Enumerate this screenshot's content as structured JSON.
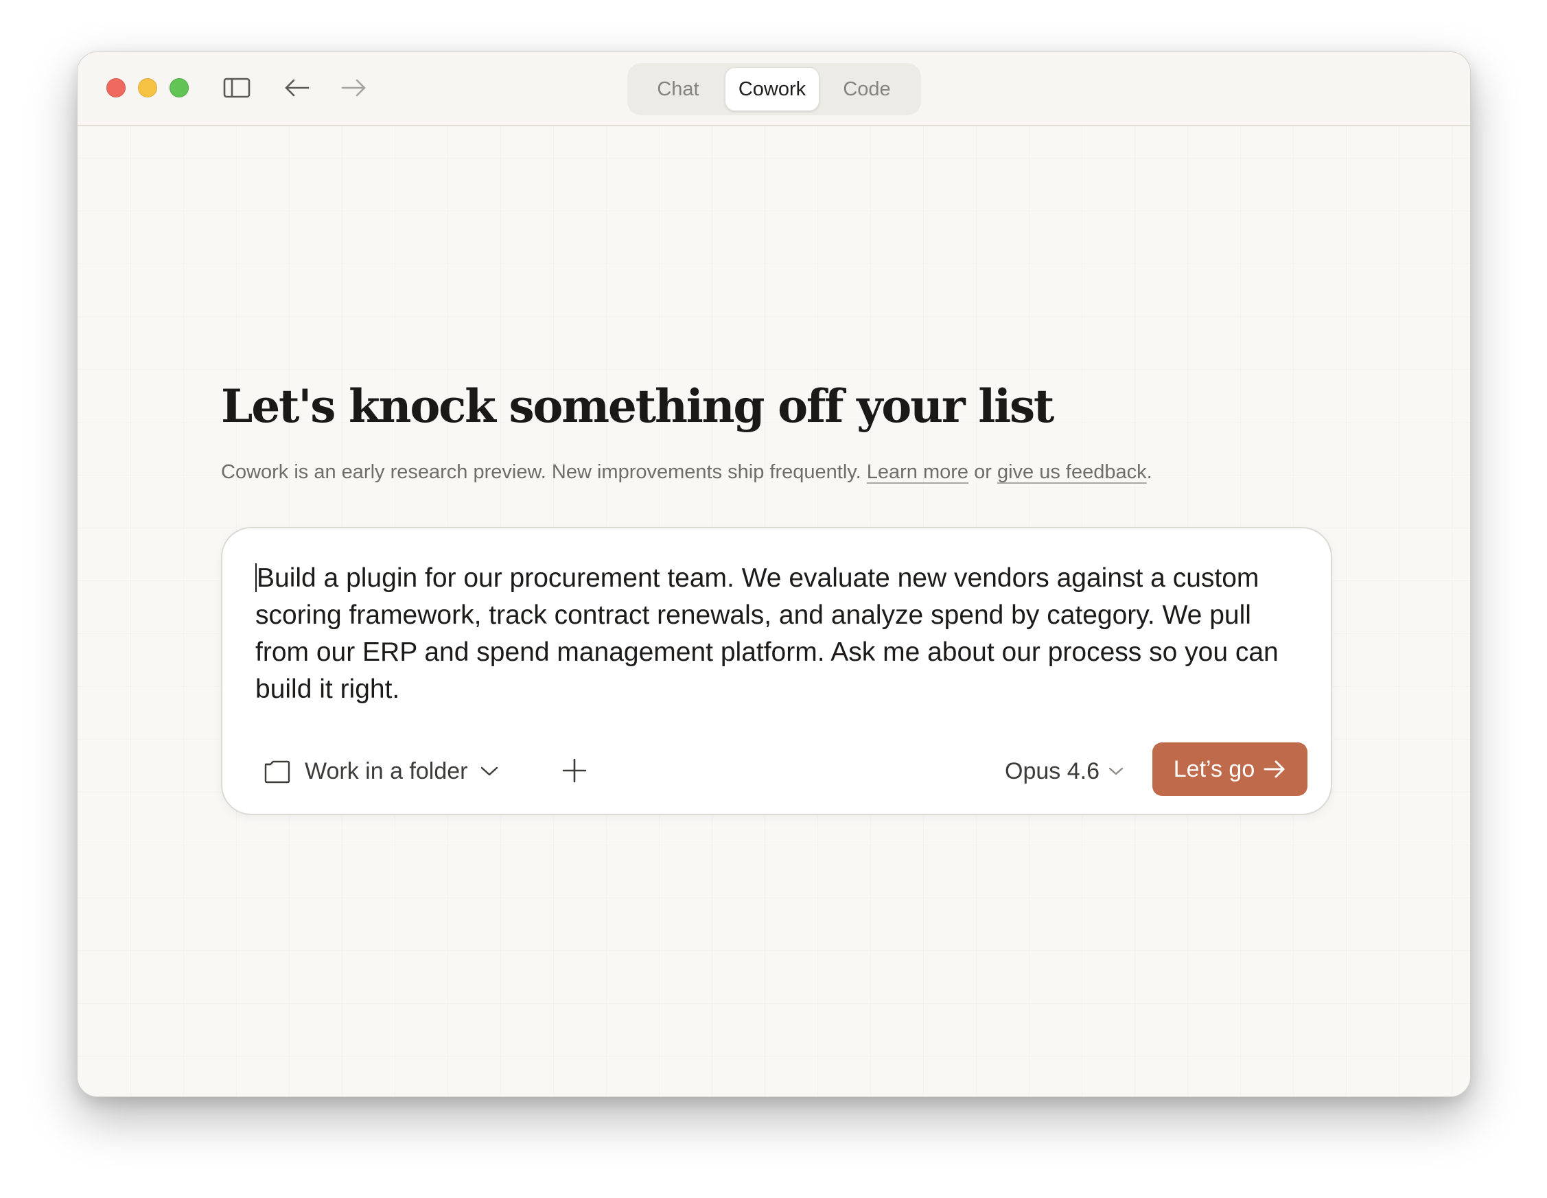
{
  "titlebar": {
    "tabs": [
      {
        "label": "Chat",
        "active": false
      },
      {
        "label": "Cowork",
        "active": true
      },
      {
        "label": "Code",
        "active": false
      }
    ]
  },
  "main": {
    "headline": "Let's knock something off your list",
    "subtitle": {
      "text": "Cowork is an early research preview. New improvements ship frequently.",
      "learn_more": "Learn more",
      "or": "or",
      "feedback": "give us feedback",
      "period": "."
    }
  },
  "composer": {
    "prompt": "Build a plugin for our procurement team. We evaluate new vendors against a custom scoring framework, track contract renewals, and analyze spend by category. We pull from our ERP and spend management platform. Ask me about our process so you can build it right.",
    "folder_label": "Work in a folder",
    "model_label": "Opus 4.6",
    "submit_label": "Let’s go"
  },
  "colors": {
    "accent": "#bf6a4a",
    "background": "#f9f8f5",
    "close": "#ee6a5f",
    "minimize": "#f5c243",
    "zoom": "#61c454"
  },
  "icons": [
    "sidebar-toggle-icon",
    "back-arrow-icon",
    "forward-arrow-icon",
    "folder-icon",
    "chevron-down-icon",
    "plus-icon",
    "arrow-right-icon"
  ]
}
